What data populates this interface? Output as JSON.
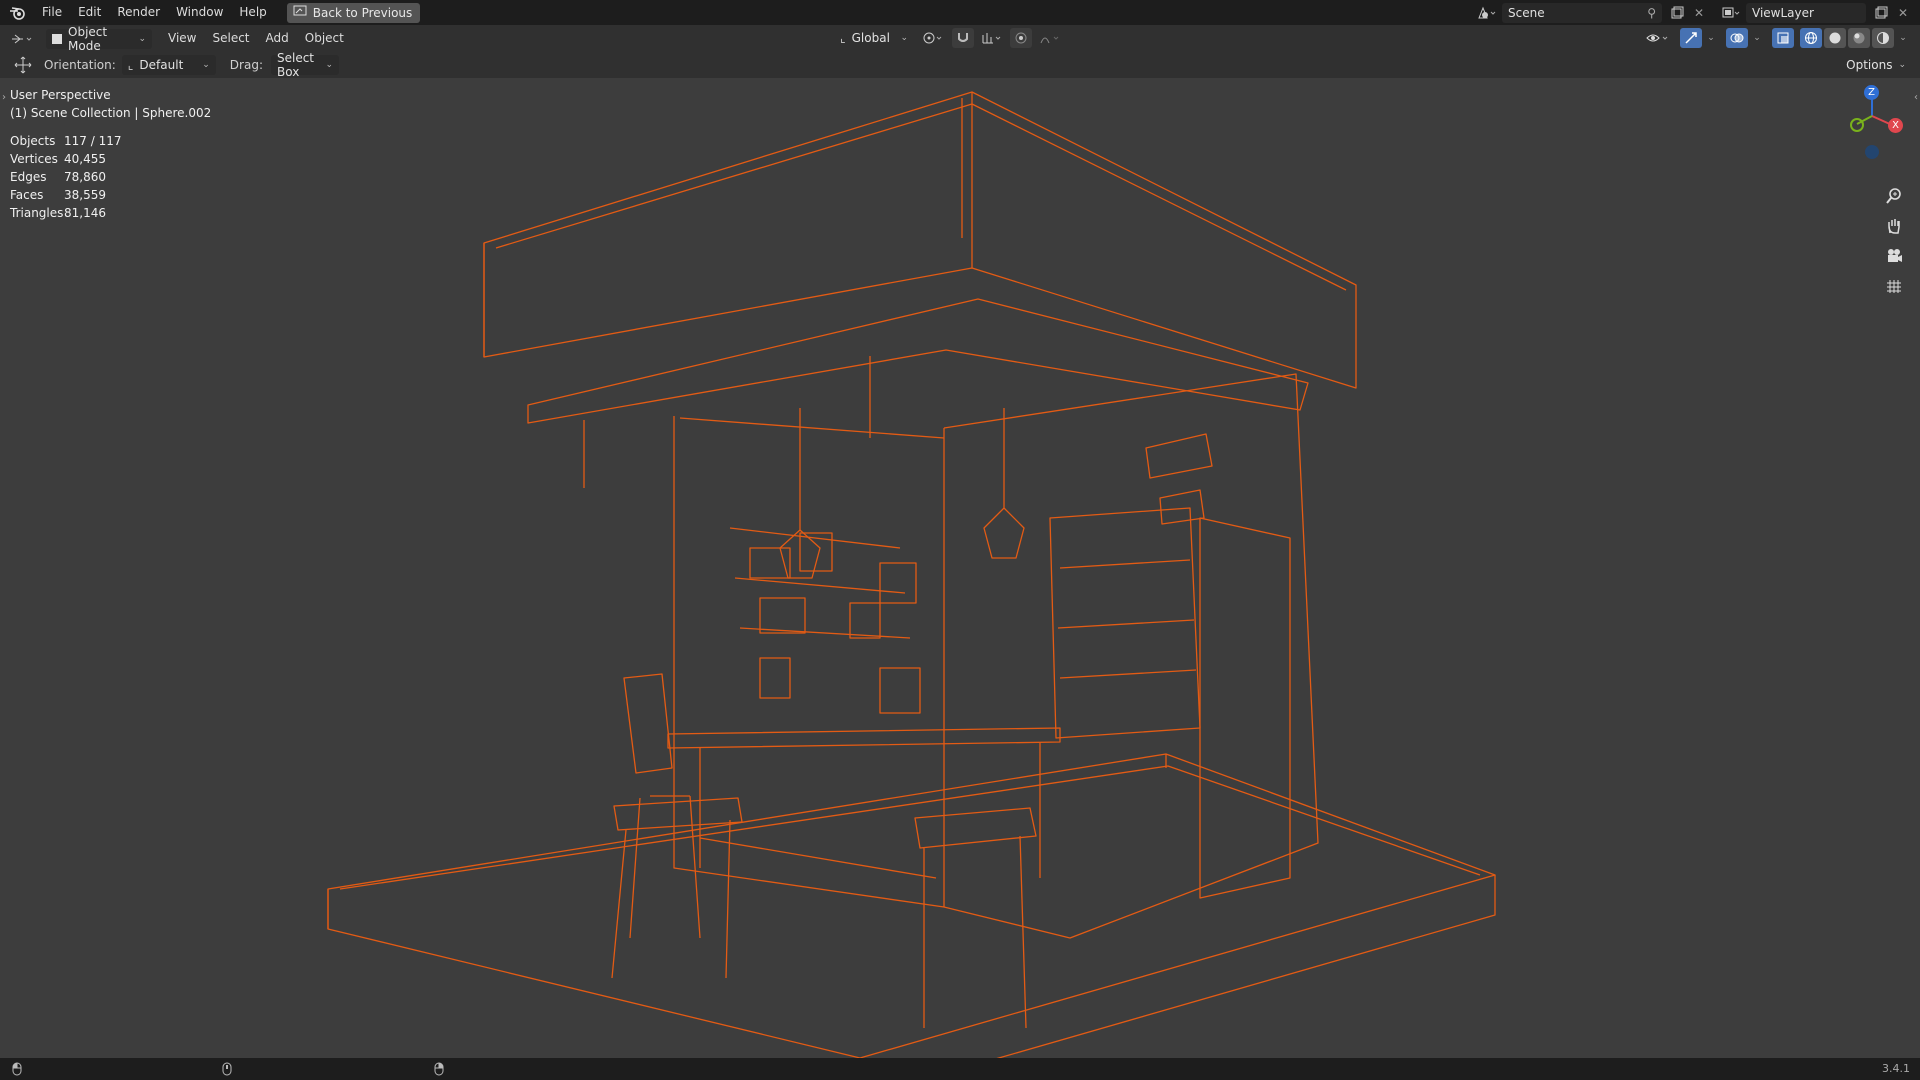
{
  "app": {
    "menu": [
      "File",
      "Edit",
      "Render",
      "Window",
      "Help"
    ],
    "back_button": "Back to Previous",
    "scene": "Scene",
    "view_layer": "ViewLayer"
  },
  "header": {
    "mode": "Object Mode",
    "menus": [
      "View",
      "Select",
      "Add",
      "Object"
    ],
    "transform_orientation": "Global",
    "options": "Options"
  },
  "toolheader": {
    "orientation_label": "Orientation:",
    "orientation_value": "Default",
    "drag_label": "Drag:",
    "drag_value": "Select Box"
  },
  "viewport": {
    "perspective": "User Perspective",
    "collection": "(1) Scene Collection | Sphere.002",
    "wire_color": "#e35b14",
    "stats": [
      {
        "label": "Objects",
        "value": "117 / 117"
      },
      {
        "label": "Vertices",
        "value": "40,455"
      },
      {
        "label": "Edges",
        "value": "78,860"
      },
      {
        "label": "Faces",
        "value": "38,559"
      },
      {
        "label": "Triangles",
        "value": "81,146"
      }
    ],
    "gizmo": {
      "z": "Z",
      "x": "X"
    }
  },
  "statusbar": {
    "version": "3.4.1"
  },
  "colors": {
    "gizmo_z": "#2f6fd6",
    "gizmo_x": "#e0474e",
    "gizmo_y": "#7ab21c",
    "wire": "#e35b14"
  },
  "icons": {
    "tools": [
      "zoom-icon",
      "hand-icon",
      "camera-icon",
      "grid-icon"
    ]
  }
}
